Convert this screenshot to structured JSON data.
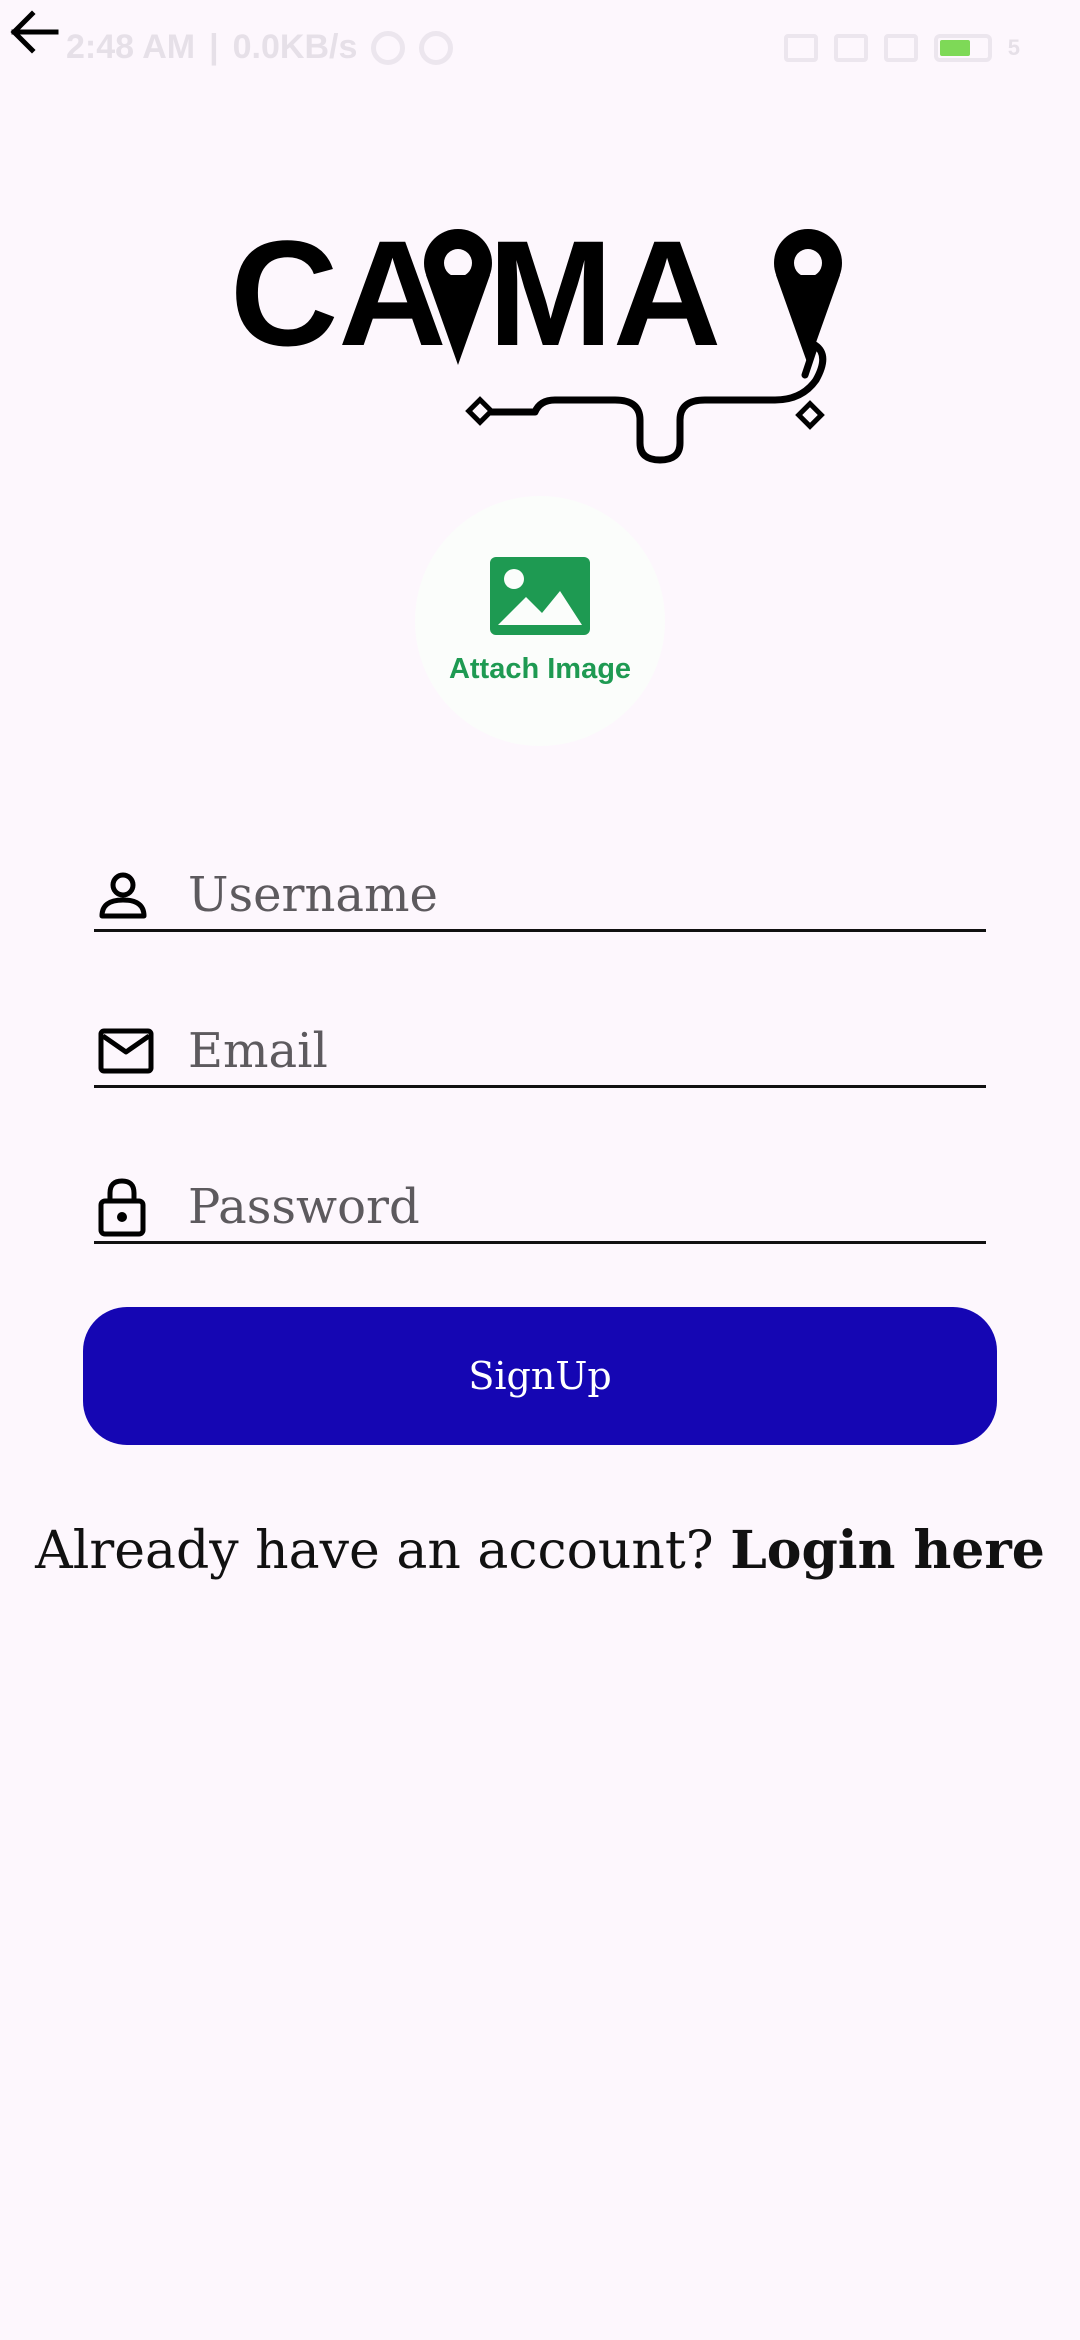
{
  "status_bar": {
    "time": "2:48 AM",
    "network_speed": "0.0KB/s",
    "battery_level": "5"
  },
  "app": {
    "logo_text": "CAPMAP"
  },
  "attach_image": {
    "label": "Attach Image"
  },
  "form": {
    "username_placeholder": "Username",
    "email_placeholder": "Email",
    "password_placeholder": "Password",
    "username_value": "",
    "email_value": "",
    "password_value": "",
    "signup_label": "SignUp"
  },
  "footer": {
    "prompt": "Already have an account?",
    "login_link": "Login here"
  },
  "colors": {
    "background": "#fdf7fd",
    "primary_button": "#1506b3",
    "attach_accent": "#1e9a52",
    "battery": "#7ed957"
  },
  "icons": {
    "back": "arrow-left-icon",
    "image": "image-icon",
    "username": "person-icon",
    "email": "mail-icon",
    "password": "lock-icon"
  }
}
